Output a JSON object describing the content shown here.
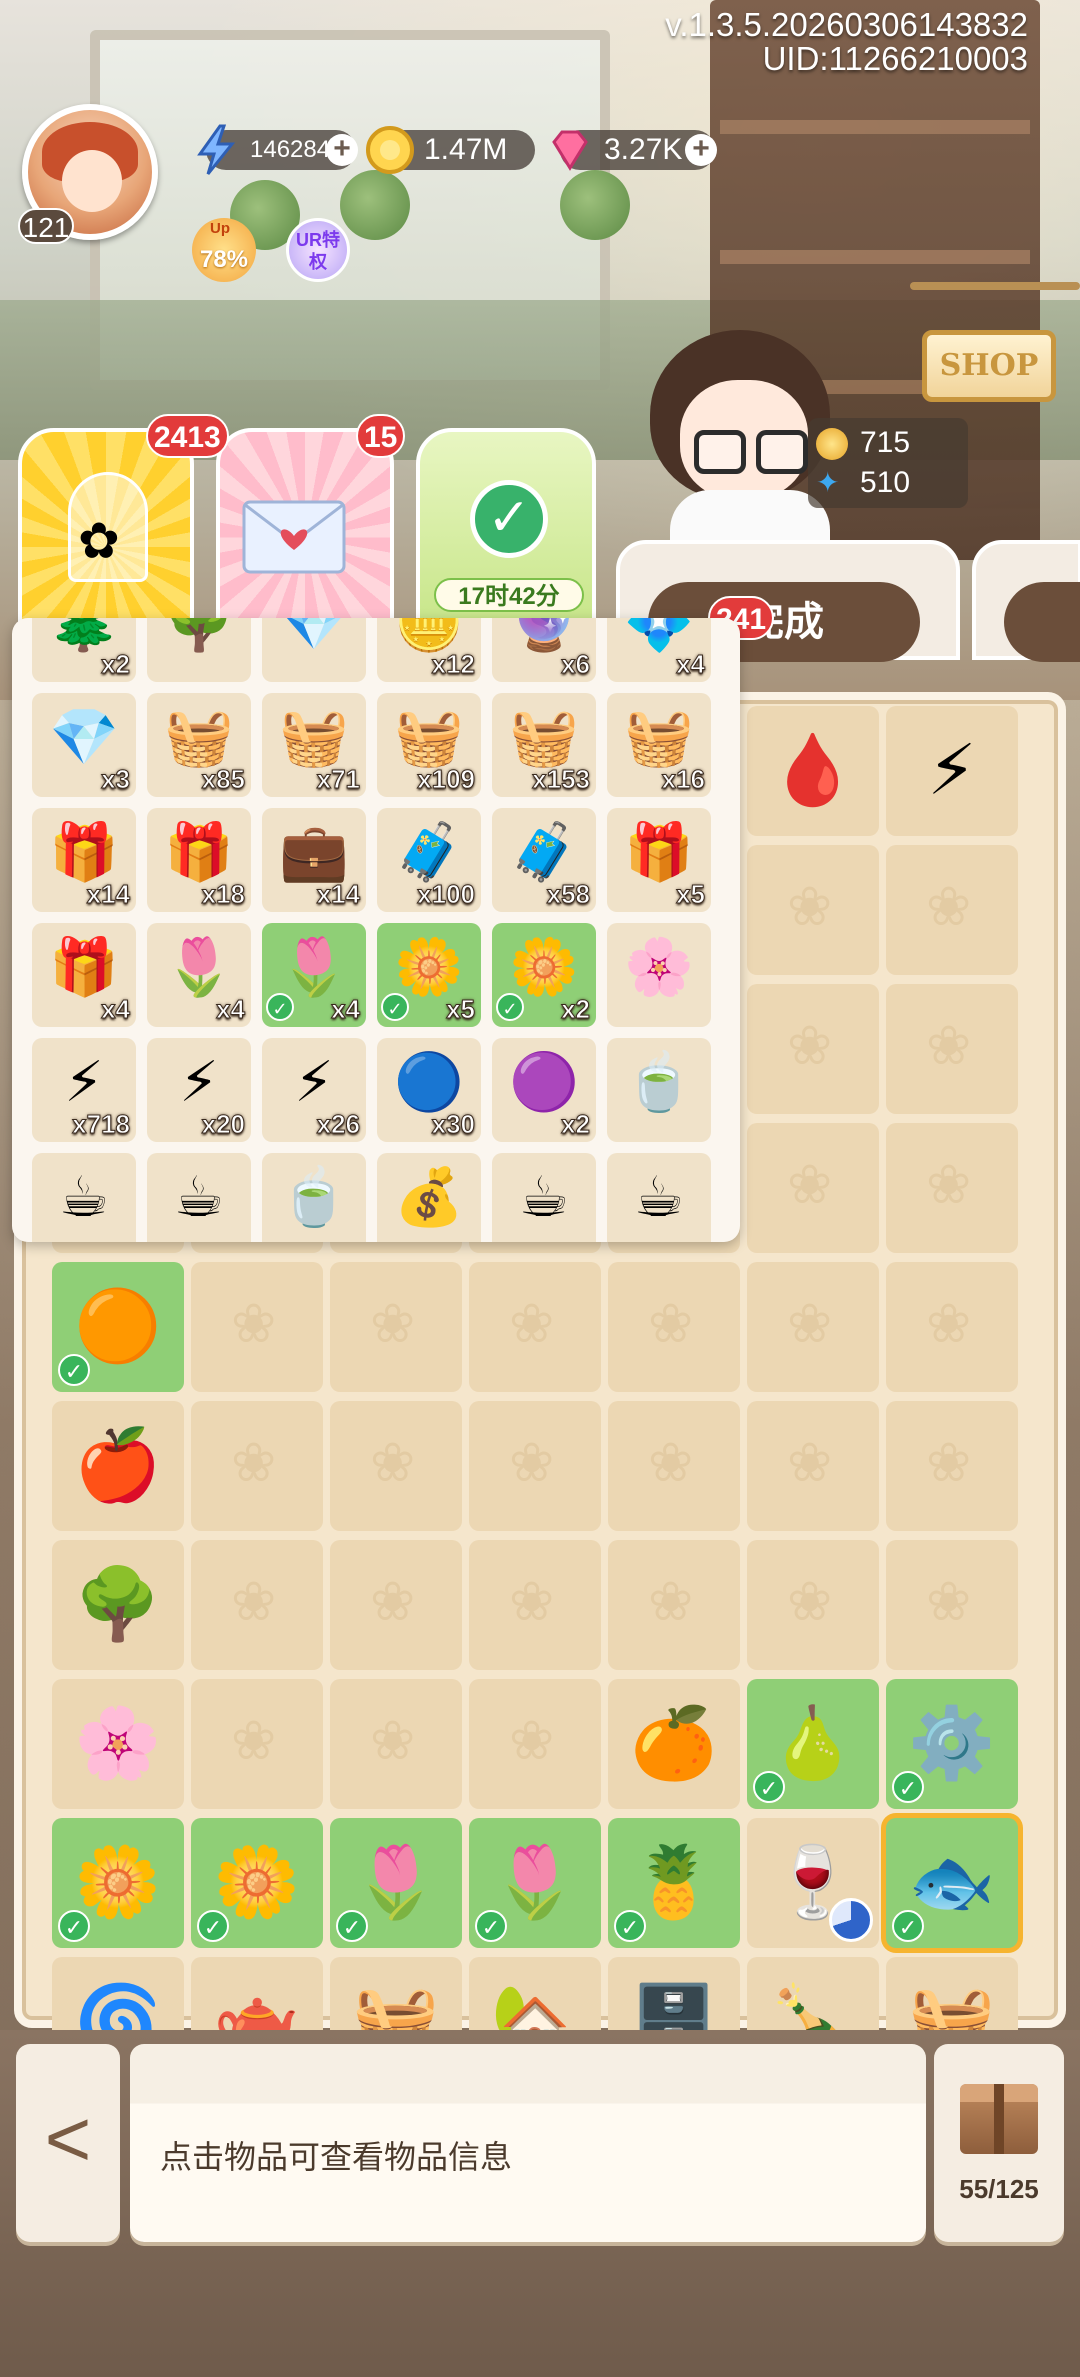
{
  "header": {
    "version": "v.1.3.5.20260306143832",
    "uid": "UID:11266210003",
    "level": "121",
    "energy": "146284",
    "coins": "1.47M",
    "gems": "3.27K",
    "buff_up_tag": "Up",
    "buff_up_value": "78%",
    "buff_ur": "UR特权"
  },
  "shop": {
    "label": "SHOP"
  },
  "score": {
    "coins": "715",
    "butterflies": "510"
  },
  "orders": {
    "badge_1": "2413",
    "badge_2": "15",
    "badge_3": "241",
    "timer": "17时42分",
    "complete_label": "完成",
    "check": "✓"
  },
  "popup": {
    "rows": [
      [
        {
          "icon": "🌲",
          "count": "x2"
        },
        {
          "icon": "🌳",
          "count": ""
        },
        {
          "icon": "💎",
          "count": ""
        },
        {
          "icon": "🪙",
          "count": "x12"
        },
        {
          "icon": "🔮",
          "count": "x6"
        },
        {
          "icon": "💠",
          "count": "x4"
        }
      ],
      [
        {
          "icon": "💎",
          "count": "x3"
        },
        {
          "icon": "🧺",
          "count": "x85"
        },
        {
          "icon": "🧺",
          "count": "x71"
        },
        {
          "icon": "🧺",
          "count": "x109"
        },
        {
          "icon": "🧺",
          "count": "x153"
        },
        {
          "icon": "🧺",
          "count": "x16"
        }
      ],
      [
        {
          "icon": "🎁",
          "count": "x14"
        },
        {
          "icon": "🎁",
          "count": "x18"
        },
        {
          "icon": "💼",
          "count": "x14"
        },
        {
          "icon": "🧳",
          "count": "x100"
        },
        {
          "icon": "🧳",
          "count": "x58"
        },
        {
          "icon": "🎁",
          "count": "x5"
        }
      ],
      [
        {
          "icon": "🎁",
          "count": "x4",
          "done": false
        },
        {
          "icon": "🌷",
          "count": "x4",
          "done": false
        },
        {
          "icon": "🌷",
          "count": "x4",
          "done": true
        },
        {
          "icon": "🌼",
          "count": "x5",
          "done": true
        },
        {
          "icon": "🌼",
          "count": "x2",
          "done": true
        },
        {
          "icon": "🌸",
          "count": "",
          "done": false
        }
      ],
      [
        {
          "icon": "⚡",
          "count": "x718"
        },
        {
          "icon": "⚡",
          "count": "x20"
        },
        {
          "icon": "⚡",
          "count": "x26"
        },
        {
          "icon": "🔵",
          "count": "x30"
        },
        {
          "icon": "🟣",
          "count": "x2"
        },
        {
          "icon": "🍵",
          "count": ""
        }
      ],
      [
        {
          "icon": "☕",
          "count": ""
        },
        {
          "icon": "☕",
          "count": ""
        },
        {
          "icon": "🍵",
          "count": ""
        },
        {
          "icon": "💰",
          "count": ""
        },
        {
          "icon": "☕",
          "count": ""
        },
        {
          "icon": "☕",
          "count": ""
        }
      ]
    ]
  },
  "info_text": "点击物品可查看物品信息",
  "storage": "55/125",
  "back_icon": "<"
}
